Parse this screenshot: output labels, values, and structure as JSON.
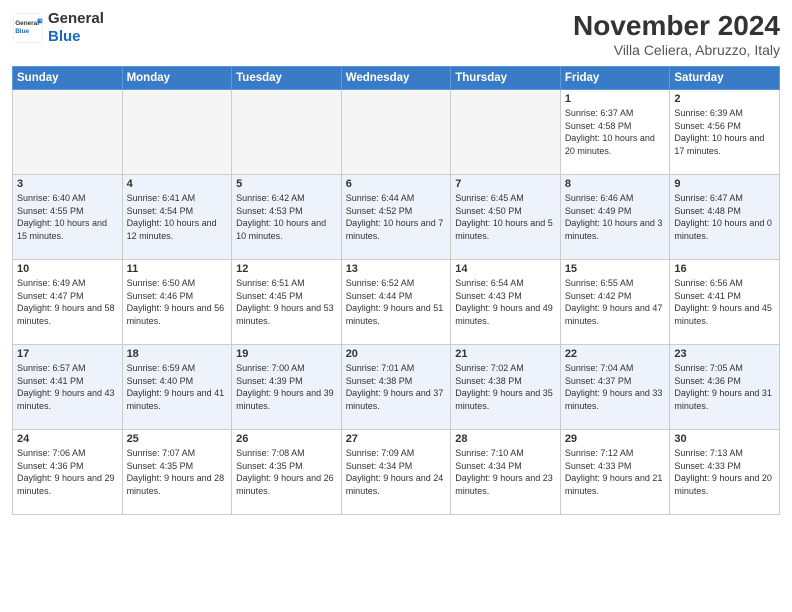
{
  "logo": {
    "text_general": "General",
    "text_blue": "Blue"
  },
  "header": {
    "month": "November 2024",
    "location": "Villa Celiera, Abruzzo, Italy"
  },
  "weekdays": [
    "Sunday",
    "Monday",
    "Tuesday",
    "Wednesday",
    "Thursday",
    "Friday",
    "Saturday"
  ],
  "weeks": [
    [
      {
        "day": "",
        "info": ""
      },
      {
        "day": "",
        "info": ""
      },
      {
        "day": "",
        "info": ""
      },
      {
        "day": "",
        "info": ""
      },
      {
        "day": "",
        "info": ""
      },
      {
        "day": "1",
        "info": "Sunrise: 6:37 AM\nSunset: 4:58 PM\nDaylight: 10 hours and 20 minutes."
      },
      {
        "day": "2",
        "info": "Sunrise: 6:39 AM\nSunset: 4:56 PM\nDaylight: 10 hours and 17 minutes."
      }
    ],
    [
      {
        "day": "3",
        "info": "Sunrise: 6:40 AM\nSunset: 4:55 PM\nDaylight: 10 hours and 15 minutes."
      },
      {
        "day": "4",
        "info": "Sunrise: 6:41 AM\nSunset: 4:54 PM\nDaylight: 10 hours and 12 minutes."
      },
      {
        "day": "5",
        "info": "Sunrise: 6:42 AM\nSunset: 4:53 PM\nDaylight: 10 hours and 10 minutes."
      },
      {
        "day": "6",
        "info": "Sunrise: 6:44 AM\nSunset: 4:52 PM\nDaylight: 10 hours and 7 minutes."
      },
      {
        "day": "7",
        "info": "Sunrise: 6:45 AM\nSunset: 4:50 PM\nDaylight: 10 hours and 5 minutes."
      },
      {
        "day": "8",
        "info": "Sunrise: 6:46 AM\nSunset: 4:49 PM\nDaylight: 10 hours and 3 minutes."
      },
      {
        "day": "9",
        "info": "Sunrise: 6:47 AM\nSunset: 4:48 PM\nDaylight: 10 hours and 0 minutes."
      }
    ],
    [
      {
        "day": "10",
        "info": "Sunrise: 6:49 AM\nSunset: 4:47 PM\nDaylight: 9 hours and 58 minutes."
      },
      {
        "day": "11",
        "info": "Sunrise: 6:50 AM\nSunset: 4:46 PM\nDaylight: 9 hours and 56 minutes."
      },
      {
        "day": "12",
        "info": "Sunrise: 6:51 AM\nSunset: 4:45 PM\nDaylight: 9 hours and 53 minutes."
      },
      {
        "day": "13",
        "info": "Sunrise: 6:52 AM\nSunset: 4:44 PM\nDaylight: 9 hours and 51 minutes."
      },
      {
        "day": "14",
        "info": "Sunrise: 6:54 AM\nSunset: 4:43 PM\nDaylight: 9 hours and 49 minutes."
      },
      {
        "day": "15",
        "info": "Sunrise: 6:55 AM\nSunset: 4:42 PM\nDaylight: 9 hours and 47 minutes."
      },
      {
        "day": "16",
        "info": "Sunrise: 6:56 AM\nSunset: 4:41 PM\nDaylight: 9 hours and 45 minutes."
      }
    ],
    [
      {
        "day": "17",
        "info": "Sunrise: 6:57 AM\nSunset: 4:41 PM\nDaylight: 9 hours and 43 minutes."
      },
      {
        "day": "18",
        "info": "Sunrise: 6:59 AM\nSunset: 4:40 PM\nDaylight: 9 hours and 41 minutes."
      },
      {
        "day": "19",
        "info": "Sunrise: 7:00 AM\nSunset: 4:39 PM\nDaylight: 9 hours and 39 minutes."
      },
      {
        "day": "20",
        "info": "Sunrise: 7:01 AM\nSunset: 4:38 PM\nDaylight: 9 hours and 37 minutes."
      },
      {
        "day": "21",
        "info": "Sunrise: 7:02 AM\nSunset: 4:38 PM\nDaylight: 9 hours and 35 minutes."
      },
      {
        "day": "22",
        "info": "Sunrise: 7:04 AM\nSunset: 4:37 PM\nDaylight: 9 hours and 33 minutes."
      },
      {
        "day": "23",
        "info": "Sunrise: 7:05 AM\nSunset: 4:36 PM\nDaylight: 9 hours and 31 minutes."
      }
    ],
    [
      {
        "day": "24",
        "info": "Sunrise: 7:06 AM\nSunset: 4:36 PM\nDaylight: 9 hours and 29 minutes."
      },
      {
        "day": "25",
        "info": "Sunrise: 7:07 AM\nSunset: 4:35 PM\nDaylight: 9 hours and 28 minutes."
      },
      {
        "day": "26",
        "info": "Sunrise: 7:08 AM\nSunset: 4:35 PM\nDaylight: 9 hours and 26 minutes."
      },
      {
        "day": "27",
        "info": "Sunrise: 7:09 AM\nSunset: 4:34 PM\nDaylight: 9 hours and 24 minutes."
      },
      {
        "day": "28",
        "info": "Sunrise: 7:10 AM\nSunset: 4:34 PM\nDaylight: 9 hours and 23 minutes."
      },
      {
        "day": "29",
        "info": "Sunrise: 7:12 AM\nSunset: 4:33 PM\nDaylight: 9 hours and 21 minutes."
      },
      {
        "day": "30",
        "info": "Sunrise: 7:13 AM\nSunset: 4:33 PM\nDaylight: 9 hours and 20 minutes."
      }
    ]
  ]
}
